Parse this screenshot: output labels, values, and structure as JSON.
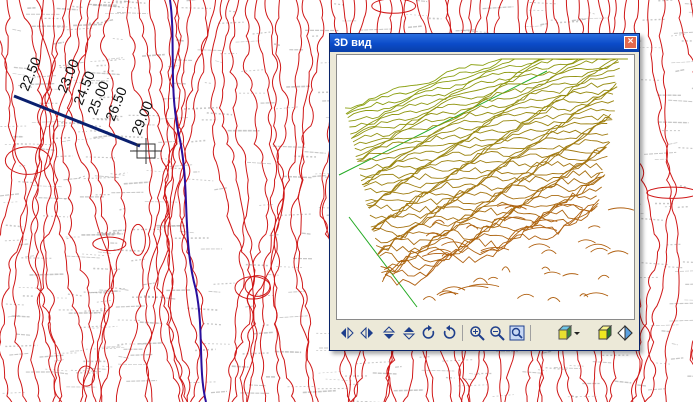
{
  "map": {
    "labels": [
      "22.50",
      "23.00",
      "24.50",
      "25.00",
      "26.50",
      "29.00"
    ],
    "colors": {
      "contour": "#d01818",
      "axis": "#2a0f9c",
      "profile": "#0a1f6e",
      "grid": "#9a9a9a"
    }
  },
  "window": {
    "title": "3D вид",
    "close_glyph": "×",
    "colors": {
      "title_bar": "#0b4bc8",
      "surface_high": "#8aa010",
      "surface_low": "#b06010",
      "axis_line": "#22aa22"
    }
  },
  "toolbar": {
    "icons": [
      "rotate-left-icon",
      "rotate-right-icon",
      "tilt-down-icon",
      "tilt-up-icon",
      "rotate-cw-icon",
      "rotate-ccw-icon",
      "zoom-in-icon",
      "zoom-out-icon",
      "zoom-extents-icon",
      "view-cube-icon",
      "dropdown-arrow-icon",
      "shaded-cube-icon",
      "perspective-icon"
    ]
  }
}
